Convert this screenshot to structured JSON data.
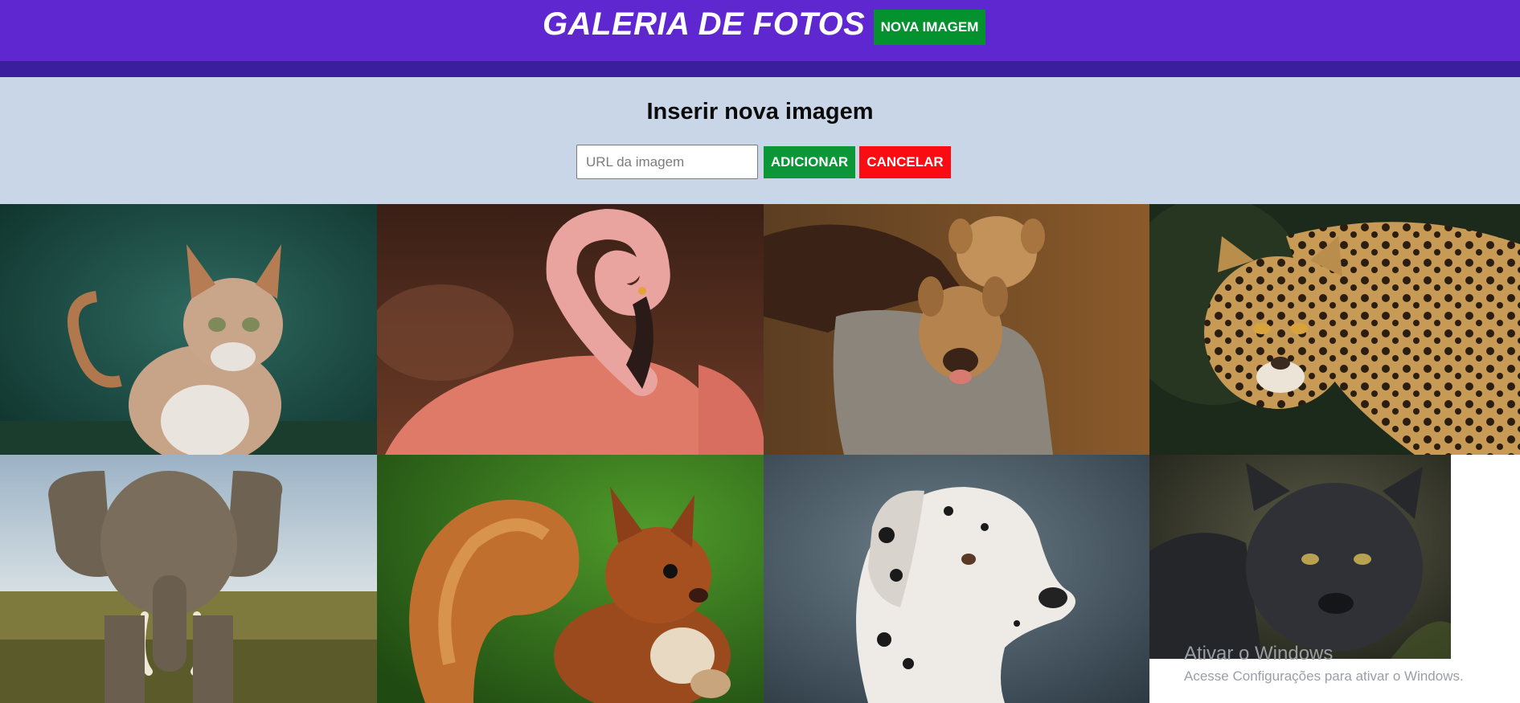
{
  "header": {
    "title": "GALERIA DE FOTOS",
    "new_image_button": "NOVA IMAGEM"
  },
  "form": {
    "heading": "Inserir nova imagem",
    "url_placeholder": "URL da imagem",
    "url_value": "",
    "add_button": "ADICIONAR",
    "cancel_button": "CANCELAR"
  },
  "gallery": {
    "photos": [
      {
        "subject": "cat"
      },
      {
        "subject": "flamingo"
      },
      {
        "subject": "puppies"
      },
      {
        "subject": "jaguar"
      },
      {
        "subject": "elephant"
      },
      {
        "subject": "squirrel"
      },
      {
        "subject": "dalmatian"
      },
      {
        "subject": "black-panther"
      }
    ]
  },
  "watermark": {
    "title": "Ativar o Windows",
    "subtitle": "Acesse Configurações para ativar o Windows."
  },
  "colors": {
    "header_bg": "#5e27cf",
    "header_strip": "#3a1e9e",
    "panel_bg": "#c9d6e8",
    "add_green": "#0b9637",
    "cancel_red": "#fb0c13"
  }
}
